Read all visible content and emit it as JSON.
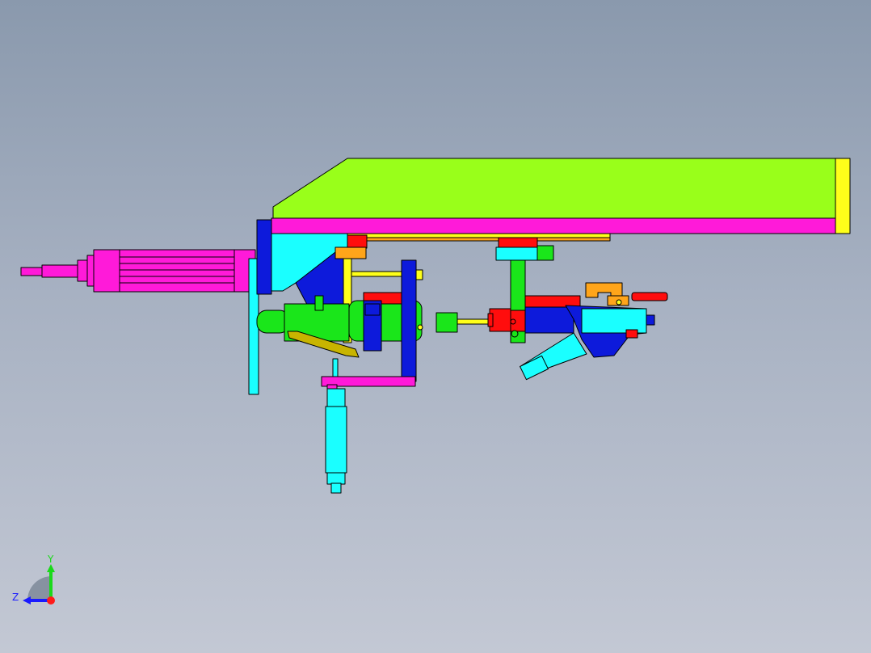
{
  "colors": {
    "background_top": "#8a99ad",
    "background_bottom": "#c3c8d4",
    "green": "#99ff1a",
    "magenta": "#ff1ad9",
    "yellow": "#ffff1a",
    "cyan": "#1affff",
    "blue": "#0d1adb",
    "red": "#ff0d0d",
    "bright_green": "#1ae61a",
    "orange": "#ffa51a",
    "olive": "#c8b400",
    "outline": "#000000"
  },
  "triad": {
    "y_label": "Y",
    "z_label": "Z",
    "y_color": "#1ad91a",
    "z_color": "#1a1aff",
    "x_color": "#ff1a1a"
  }
}
